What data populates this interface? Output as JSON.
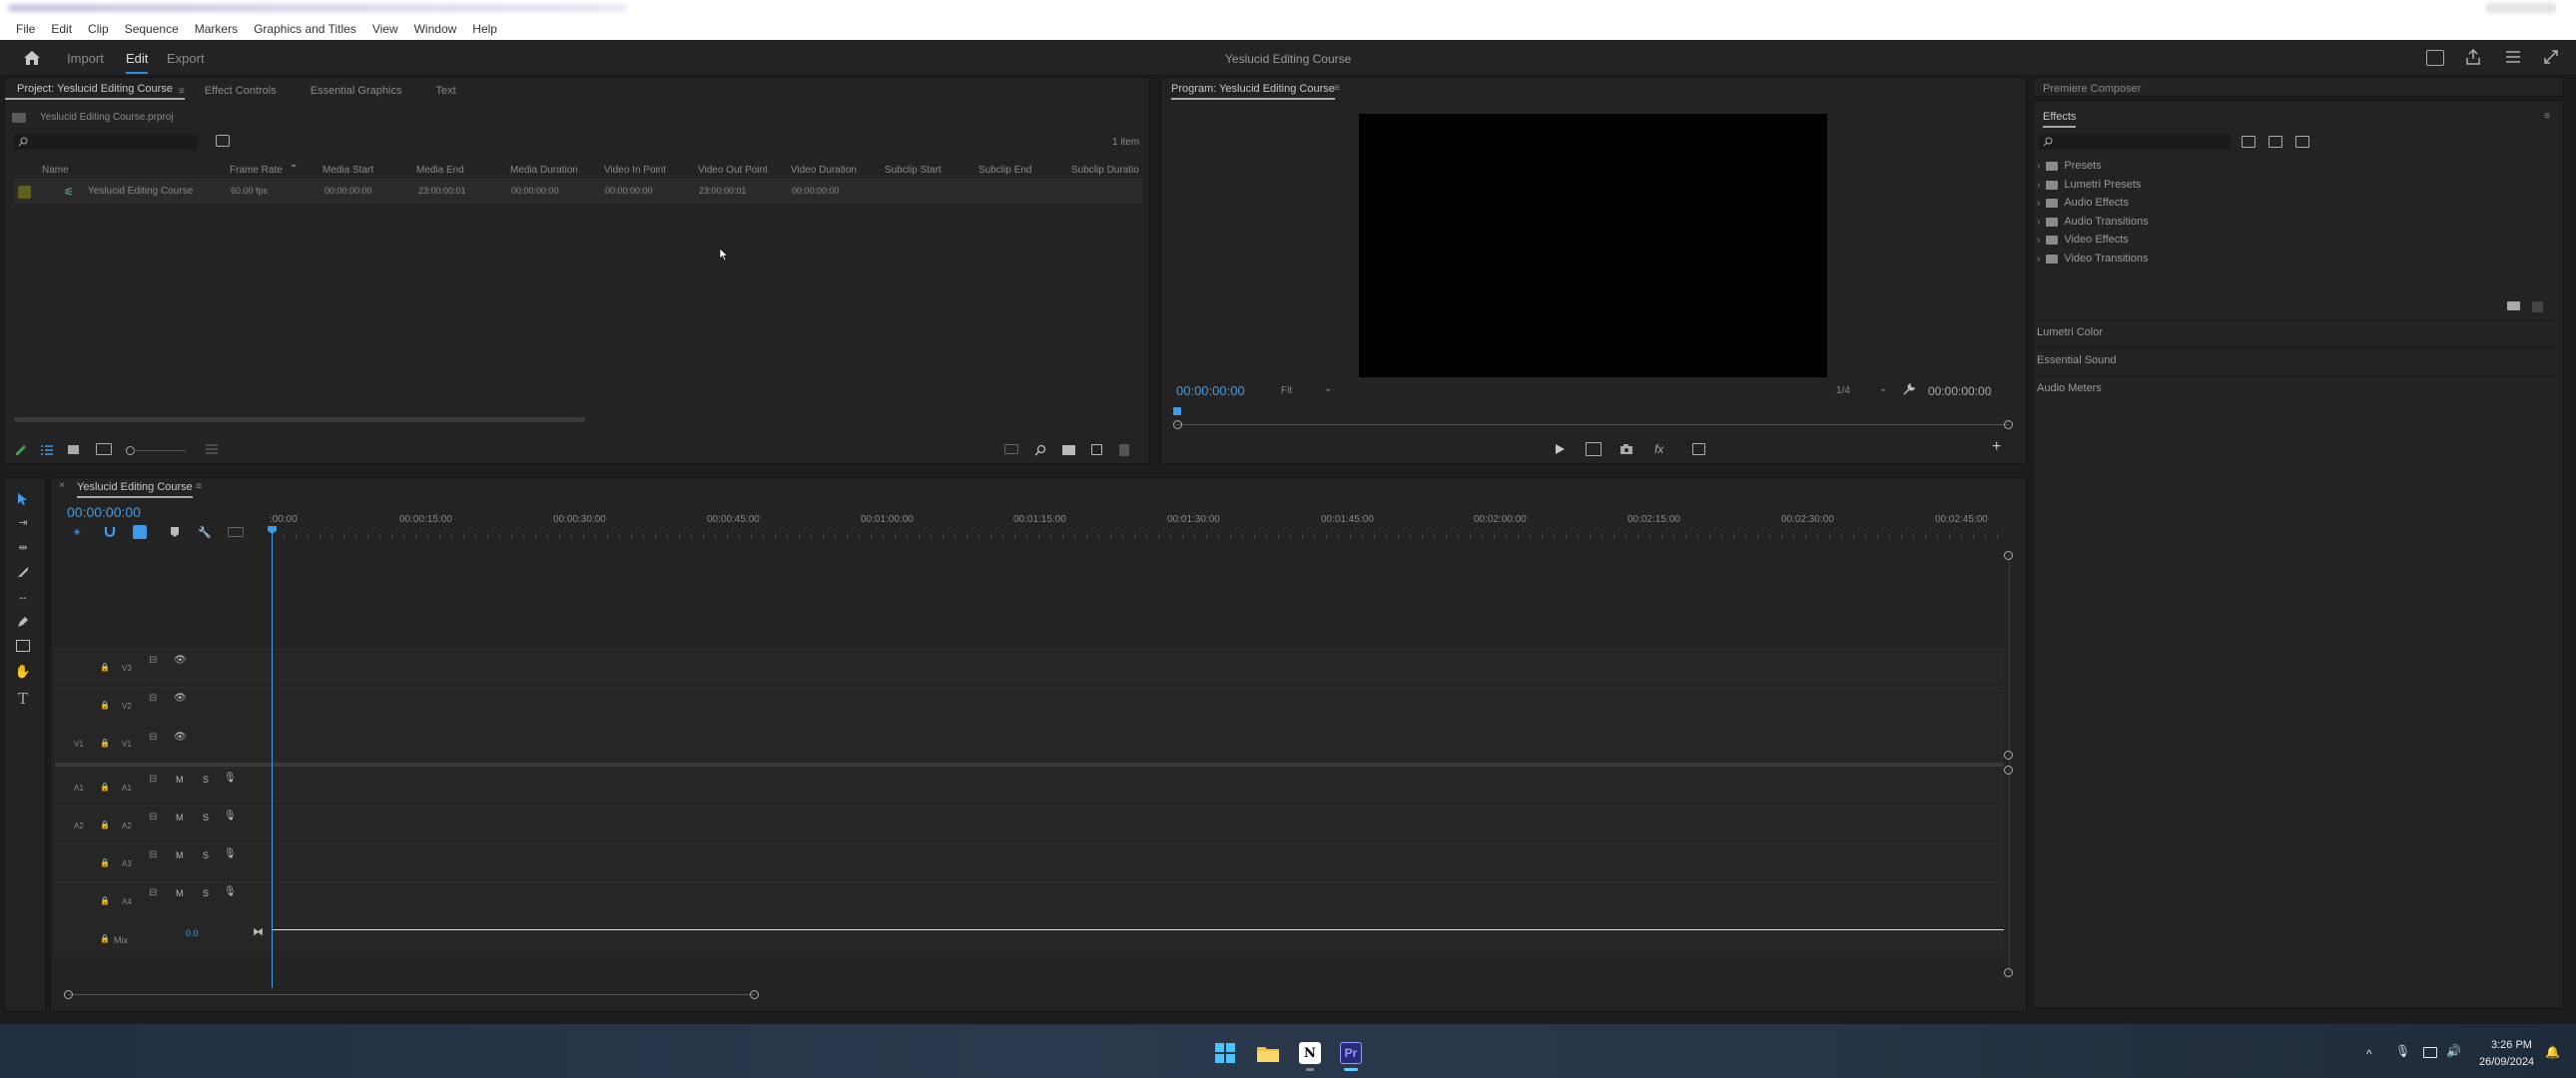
{
  "menubar": {
    "items": [
      "File",
      "Edit",
      "Clip",
      "Sequence",
      "Markers",
      "Graphics and Titles",
      "View",
      "Window",
      "Help"
    ]
  },
  "workspace": {
    "tabs": [
      "Import",
      "Edit",
      "Export"
    ],
    "active": "Edit",
    "title": "Yeslucid Editing Course"
  },
  "project": {
    "tabs": [
      "Project: Yeslucid Editing Course",
      "Effect Controls",
      "Essential Graphics",
      "Text"
    ],
    "file": "Yeslucid Editing Course.prproj",
    "item_count": "1 item",
    "columns": [
      "Name",
      "Frame Rate",
      "Media Start",
      "Media End",
      "Media Duration",
      "Video In Point",
      "Video Out Point",
      "Video Duration",
      "Subclip Start",
      "Subclip End",
      "Subclip Duratio"
    ],
    "row": {
      "name": "Yeslucid Editing Course",
      "frame_rate": "60.00 fps",
      "media_start": "00:00:00:00",
      "media_end": "23:00:00:01",
      "media_duration": "00:00:00:00",
      "video_in": "00:00:00:00",
      "video_out": "23:00:00:01",
      "video_duration": "00:00:00:00"
    }
  },
  "program": {
    "tab": "Program: Yeslucid Editing Course",
    "timecode": "00:00:00:00",
    "fit": "Fit",
    "resolution": "1/4",
    "end_timecode": "00:00:00:00"
  },
  "timeline": {
    "tab": "Yeslucid Editing Course",
    "timecode": "00:00:00:00",
    "ticks": [
      ":00:00",
      "00:00:15:00",
      "00:00:30:00",
      "00:00:45:00",
      "00:01:00:00",
      "00:01:15:00",
      "00:01:30:00",
      "00:01:45:00",
      "00:02:00:00",
      "00:02:15:00",
      "00:02:30:00",
      "00:02:45:00"
    ],
    "video_tracks": [
      "V3",
      "V2",
      "V1"
    ],
    "audio_tracks": [
      "A1",
      "A2",
      "A3",
      "A4"
    ],
    "mix_label": "Mix",
    "mix_value": "0.0",
    "v1_source": "V1",
    "audio_sources": [
      "A1",
      "A2"
    ],
    "mute": "M",
    "solo": "S"
  },
  "right": {
    "composer": "Premiere Composer",
    "effects_title": "Effects",
    "effects": [
      "Presets",
      "Lumetri Presets",
      "Audio Effects",
      "Audio Transitions",
      "Video Effects",
      "Video Transitions"
    ],
    "sections": [
      "Lumetri Color",
      "Essential Sound",
      "Audio Meters"
    ]
  },
  "taskbar": {
    "time": "3:26 PM",
    "date": "26/09/2024",
    "app_label": "Pr",
    "notion_label": "N"
  },
  "colors": {
    "accent": "#2d8ceb",
    "timecode": "#3d9be9",
    "premiere": "#2a2a7a"
  }
}
